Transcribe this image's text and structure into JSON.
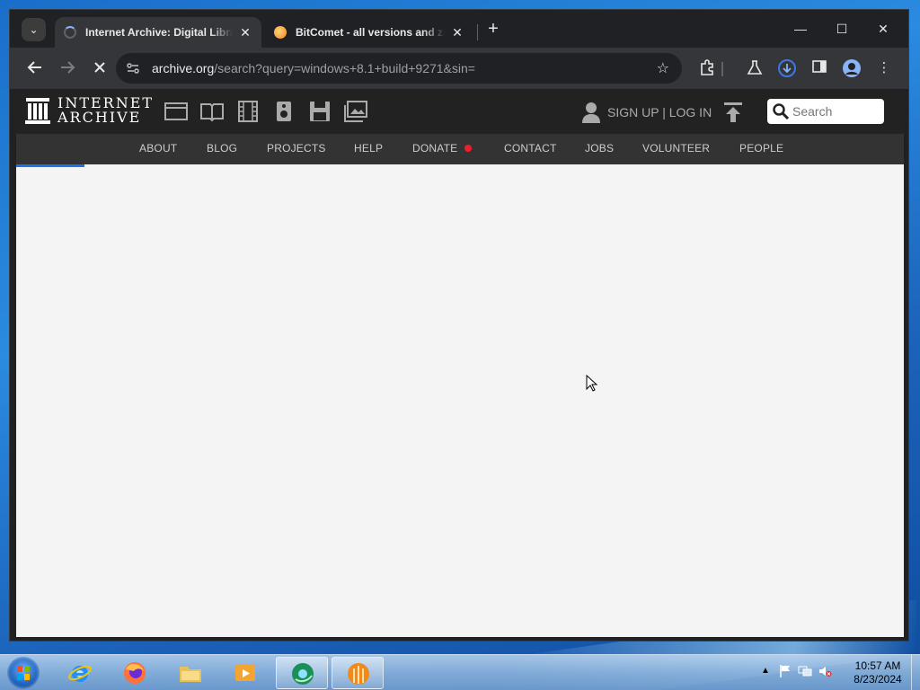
{
  "browser": {
    "tabs": [
      {
        "title": "Internet Archive: Digital Library",
        "active": true
      },
      {
        "title": "BitComet - all versions and zip files",
        "active": false
      }
    ],
    "tab_close_glyph": "✕",
    "new_tab_glyph": "+",
    "window_controls": {
      "minimize": "—",
      "maximize": "☐",
      "close": "✕"
    },
    "address": {
      "host": "archive.org",
      "path": "/search?query=windows+8.1+build+9271&sin="
    }
  },
  "archive": {
    "logo_line1": "INTERNET",
    "logo_line2": "ARCHIVE",
    "media_icons": [
      "web-icon",
      "texts-icon",
      "video-icon",
      "audio-icon",
      "software-icon",
      "images-icon"
    ],
    "signup_label": "SIGN UP | LOG IN",
    "search_placeholder": "Search",
    "nav": [
      "ABOUT",
      "BLOG",
      "PROJECTS",
      "HELP",
      "DONATE",
      "CONTACT",
      "JOBS",
      "VOLUNTEER",
      "PEOPLE"
    ]
  },
  "taskbar": {
    "apps": [
      "internet-explorer-icon",
      "firefox-icon",
      "file-explorer-icon",
      "media-player-icon",
      "chrome-icon",
      "bitcomet-icon"
    ],
    "clock_time": "10:57 AM",
    "clock_date": "8/23/2024"
  },
  "colors": {
    "accent": "#1a73e8",
    "donate_dot": "#f01d2d",
    "ia_header": "#222222",
    "ia_nav": "#333333"
  }
}
